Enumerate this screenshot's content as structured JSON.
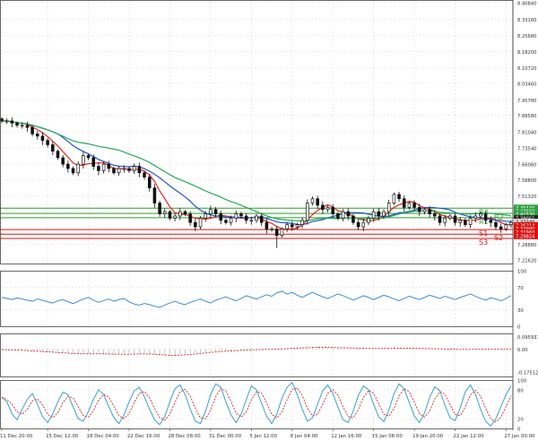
{
  "chart_data": {
    "type": "candlestick",
    "price_panel": {
      "y_ticks": [
        8.4084,
        8.3316,
        8.2568,
        8.182,
        8.1072,
        8.0346,
        7.9578,
        7.8858,
        7.8104,
        7.7354,
        7.6606,
        7.588,
        7.5132,
        7.4384,
        7.3636,
        7.2888,
        7.2162
      ],
      "y_tick_labels": [
        "8.40840",
        "8.33160",
        "8.25680",
        "8.18200",
        "8.10720",
        "8.03460",
        "7.95780",
        "7.88580",
        "7.81040",
        "7.73540",
        "7.66060",
        "7.58800",
        "7.51320",
        "7.43840",
        "7.36360",
        "7.28880",
        "7.21620"
      ],
      "ylim": [
        7.2,
        8.42
      ],
      "levels": [
        {
          "label": "R3",
          "value": 7.456,
          "color": "#2e9e2e"
        },
        {
          "label": "R2",
          "value": 7.432,
          "color": "#2e9e2e"
        },
        {
          "label": "R1",
          "value": 7.412,
          "color": "#2e9e2e"
        },
        {
          "label": "S1",
          "value": 7.357,
          "color": "#dd1111"
        },
        {
          "label": "S2",
          "value": 7.336,
          "color": "#dd1111"
        },
        {
          "label": "S3",
          "value": 7.316,
          "color": "#dd1111"
        }
      ],
      "price_tags": [
        {
          "text": "7.45440",
          "value": 7.458,
          "color": "#2ea043"
        },
        {
          "text": "7.43660",
          "value": 7.443,
          "color": "#2ea043"
        },
        {
          "text": "7.41530",
          "value": 7.428,
          "color": "#2ea043"
        },
        {
          "text": "7.39051",
          "value": 7.409,
          "color": "#222222"
        },
        {
          "text": "7.37340",
          "value": 7.393,
          "color": "#e0e0e0"
        },
        {
          "text": "7.36214",
          "value": 7.377,
          "color": "#dd1111"
        },
        {
          "text": "7.33990",
          "value": 7.361,
          "color": "#dd1111"
        },
        {
          "text": "7.31960",
          "value": 7.345,
          "color": "#dd1111"
        },
        {
          "text": "7.29824",
          "value": 7.327,
          "color": "#dd1111"
        }
      ],
      "close": [
        7.86,
        7.86,
        7.85,
        7.84,
        7.84,
        7.83,
        7.8,
        7.79,
        7.77,
        7.75,
        7.72,
        7.69,
        7.66,
        7.64,
        7.62,
        7.66,
        7.7,
        7.69,
        7.65,
        7.63,
        7.66,
        7.64,
        7.62,
        7.64,
        7.64,
        7.63,
        7.65,
        7.62,
        7.6,
        7.55,
        7.48,
        7.43,
        7.44,
        7.41,
        7.42,
        7.44,
        7.43,
        7.39,
        7.37,
        7.41,
        7.43,
        7.45,
        7.43,
        7.4,
        7.39,
        7.41,
        7.43,
        7.42,
        7.4,
        7.4,
        7.42,
        7.39,
        7.36,
        7.36,
        7.33,
        7.36,
        7.38,
        7.37,
        7.38,
        7.4,
        7.48,
        7.5,
        7.47,
        7.45,
        7.46,
        7.43,
        7.41,
        7.44,
        7.42,
        7.39,
        7.37,
        7.39,
        7.41,
        7.44,
        7.42,
        7.44,
        7.48,
        7.52,
        7.5,
        7.46,
        7.48,
        7.46,
        7.44,
        7.45,
        7.43,
        7.42,
        7.39,
        7.41,
        7.42,
        7.39,
        7.4,
        7.38,
        7.41,
        7.42,
        7.43,
        7.4,
        7.39,
        7.37,
        7.36,
        7.38,
        7.39
      ],
      "moving_averages": [
        {
          "color": "#ee2222"
        },
        {
          "color": "#2255cc"
        },
        {
          "color": "#22aa55"
        }
      ]
    },
    "rsi_panel": {
      "y_ticks": [
        100,
        70,
        30,
        0
      ],
      "y_tick_labels": [
        "100",
        "70",
        "30",
        "0"
      ],
      "ylim": [
        0,
        100
      ],
      "level_lines": [
        70,
        30
      ],
      "values": [
        52,
        50,
        48,
        51,
        49,
        47,
        45,
        49,
        47,
        44,
        42,
        46,
        48,
        44,
        41,
        45,
        49,
        52,
        47,
        43,
        46,
        49,
        45,
        48,
        50,
        44,
        40,
        38,
        41,
        39,
        36,
        34,
        38,
        42,
        45,
        41,
        39,
        43,
        46,
        49,
        45,
        42,
        47,
        50,
        53,
        49,
        46,
        50,
        55,
        52,
        49,
        53,
        57,
        54,
        60,
        63,
        58,
        61,
        56,
        52,
        57,
        61,
        57,
        53,
        50,
        54,
        58,
        55,
        51,
        47,
        51,
        55,
        52,
        48,
        52,
        56,
        53,
        49,
        46,
        50,
        54,
        51,
        48,
        52,
        56,
        53,
        50,
        54,
        51,
        48,
        52,
        55,
        58,
        54,
        50,
        47,
        51,
        49,
        46,
        50,
        55
      ]
    },
    "macd_panel": {
      "y_ticks": [
        0.095931,
        0.0,
        -0.175129
      ],
      "y_tick_labels": [
        "0.095931",
        "0.00",
        "-0.175129"
      ],
      "ylim": [
        -0.21,
        0.12
      ],
      "histogram": [
        -0.004,
        -0.006,
        -0.008,
        -0.01,
        -0.012,
        -0.015,
        -0.018,
        -0.02,
        -0.022,
        -0.025,
        -0.028,
        -0.03,
        -0.032,
        -0.034,
        -0.036,
        -0.037,
        -0.037,
        -0.036,
        -0.035,
        -0.036,
        -0.038,
        -0.04,
        -0.041,
        -0.04,
        -0.039,
        -0.038,
        -0.037,
        -0.036,
        -0.037,
        -0.04,
        -0.044,
        -0.048,
        -0.05,
        -0.049,
        -0.046,
        -0.043,
        -0.04,
        -0.036,
        -0.032,
        -0.028,
        -0.024,
        -0.02,
        -0.017,
        -0.015,
        -0.013,
        -0.011,
        -0.009,
        -0.007,
        -0.005,
        -0.004,
        -0.003,
        -0.002,
        -0.001,
        0.0,
        0.002,
        0.004,
        0.006,
        0.008,
        0.01,
        0.012,
        0.013,
        0.014,
        0.014,
        0.013,
        0.012,
        0.011,
        0.01,
        0.009,
        0.008,
        0.007,
        0.006,
        0.005,
        0.004,
        0.004,
        0.005,
        0.006,
        0.007,
        0.008,
        0.008,
        0.007,
        0.006,
        0.005,
        0.004,
        0.003,
        0.002,
        0.001,
        0.0,
        -0.001,
        -0.002,
        -0.003,
        -0.003,
        -0.002,
        -0.002,
        -0.001,
        -0.001,
        -0.001,
        -0.002,
        -0.002,
        -0.001,
        -0.001,
        0.0
      ],
      "signal_color": "#dd2222"
    },
    "stoch_panel": {
      "y_ticks": [
        100,
        80,
        20,
        0
      ],
      "y_tick_labels": [
        "100",
        "80",
        "20",
        "0"
      ],
      "ylim": [
        0,
        100
      ],
      "level_lines": [
        80,
        20
      ],
      "k_values": [
        65,
        55,
        30,
        18,
        40,
        60,
        72,
        50,
        25,
        12,
        30,
        55,
        75,
        70,
        45,
        20,
        15,
        35,
        60,
        80,
        70,
        45,
        22,
        10,
        28,
        55,
        78,
        85,
        66,
        40,
        18,
        8,
        25,
        55,
        82,
        90,
        70,
        40,
        15,
        10,
        35,
        70,
        92,
        85,
        55,
        28,
        12,
        30,
        60,
        88,
        80,
        52,
        25,
        10,
        30,
        62,
        85,
        95,
        70,
        40,
        15,
        22,
        50,
        78,
        90,
        72,
        44,
        18,
        12,
        36,
        68,
        88,
        80,
        50,
        24,
        14,
        38,
        72,
        92,
        82,
        54,
        26,
        12,
        32,
        64,
        86,
        78,
        48,
        22,
        16,
        42,
        76,
        90,
        70,
        40,
        15,
        5,
        20,
        45,
        70,
        88
      ],
      "k_color": "#2299cc",
      "d_color": "#dd2222"
    },
    "x_tick_labels": [
      "11 Dec 20:00",
      "15 Dec 12:00",
      "18 Dec 04:00",
      "22 Dec 16:00",
      "28 Dec 08:00",
      "31 Dec 00:00",
      "5 Jan 12:00",
      "8 Jan 04:00",
      "12 Jan 16:00",
      "15 Jan 08:00",
      "19 Jan 20:00",
      "22 Jan 12:00",
      "27 Jan 00:00"
    ],
    "x_tick_index": [
      0,
      9,
      17,
      25,
      33,
      41,
      49,
      57,
      65,
      73,
      81,
      89,
      99
    ]
  }
}
